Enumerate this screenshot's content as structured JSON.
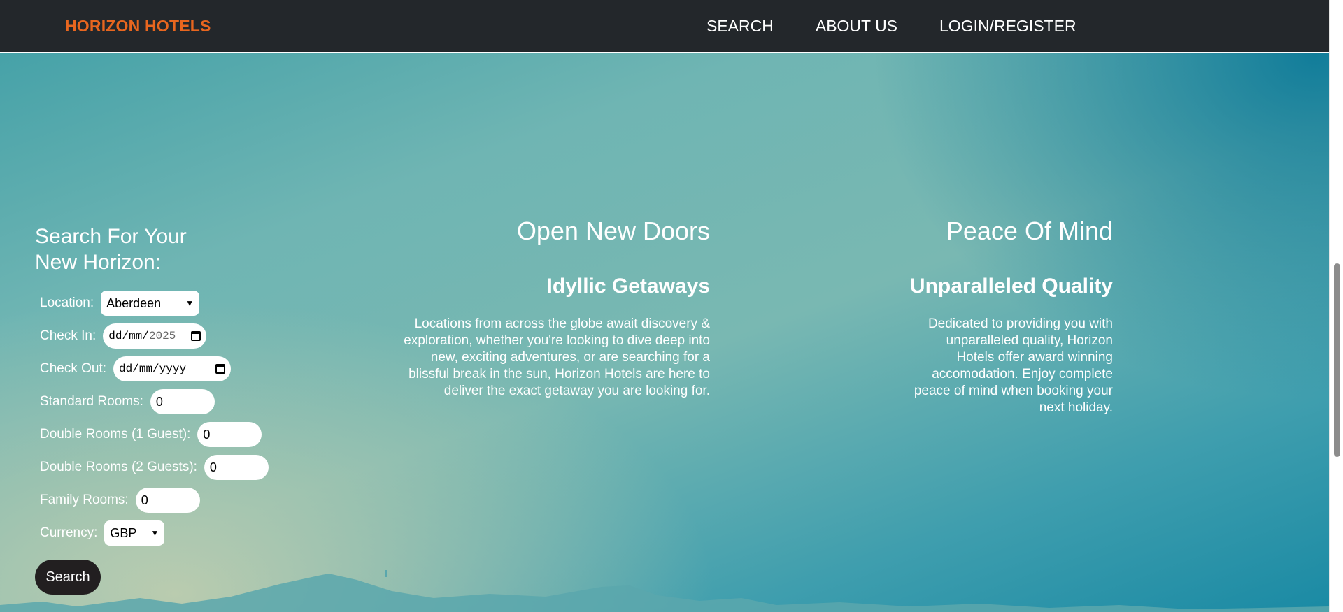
{
  "navbar": {
    "brand": "HORIZON HOTELS",
    "links": [
      "SEARCH",
      "ABOUT US",
      "LOGIN/REGISTER"
    ]
  },
  "search": {
    "title": "Search For Your New Horizon:",
    "location": {
      "label": "Location:",
      "value": "Aberdeen"
    },
    "check_in": {
      "label": "Check In:",
      "placeholder_day_month": "dd/mm/",
      "year": "2025"
    },
    "check_out": {
      "label": "Check Out:",
      "placeholder": "dd/mm/yyyy"
    },
    "standard_rooms": {
      "label": "Standard Rooms:",
      "value": "0"
    },
    "double_rooms_1": {
      "label": "Double Rooms (1 Guest):",
      "value": "0"
    },
    "double_rooms_2": {
      "label": "Double Rooms (2 Guests):",
      "value": "0"
    },
    "family_rooms": {
      "label": "Family Rooms:",
      "value": "0"
    },
    "currency": {
      "label": "Currency:",
      "value": "GBP"
    },
    "button": "Search"
  },
  "features": [
    {
      "heading": "Open New Doors",
      "subheading": "Idyllic Getaways",
      "body": "Locations from across the globe await discovery & exploration, whether you're looking to dive deep into new, exciting adventures, or are searching for a blissful break in the sun, Horizon Hotels are here to deliver the exact getaway you are looking for."
    },
    {
      "heading": "Peace Of Mind",
      "subheading": "Unparalleled Quality",
      "body": "Dedicated to providing you with unparalleled quality, Horizon Hotels offer award winning accomodation. Enjoy complete peace of mind when booking your next holiday."
    }
  ],
  "colors": {
    "brand": "#e8661f",
    "navbar": "#23272b",
    "button": "#221f20"
  }
}
